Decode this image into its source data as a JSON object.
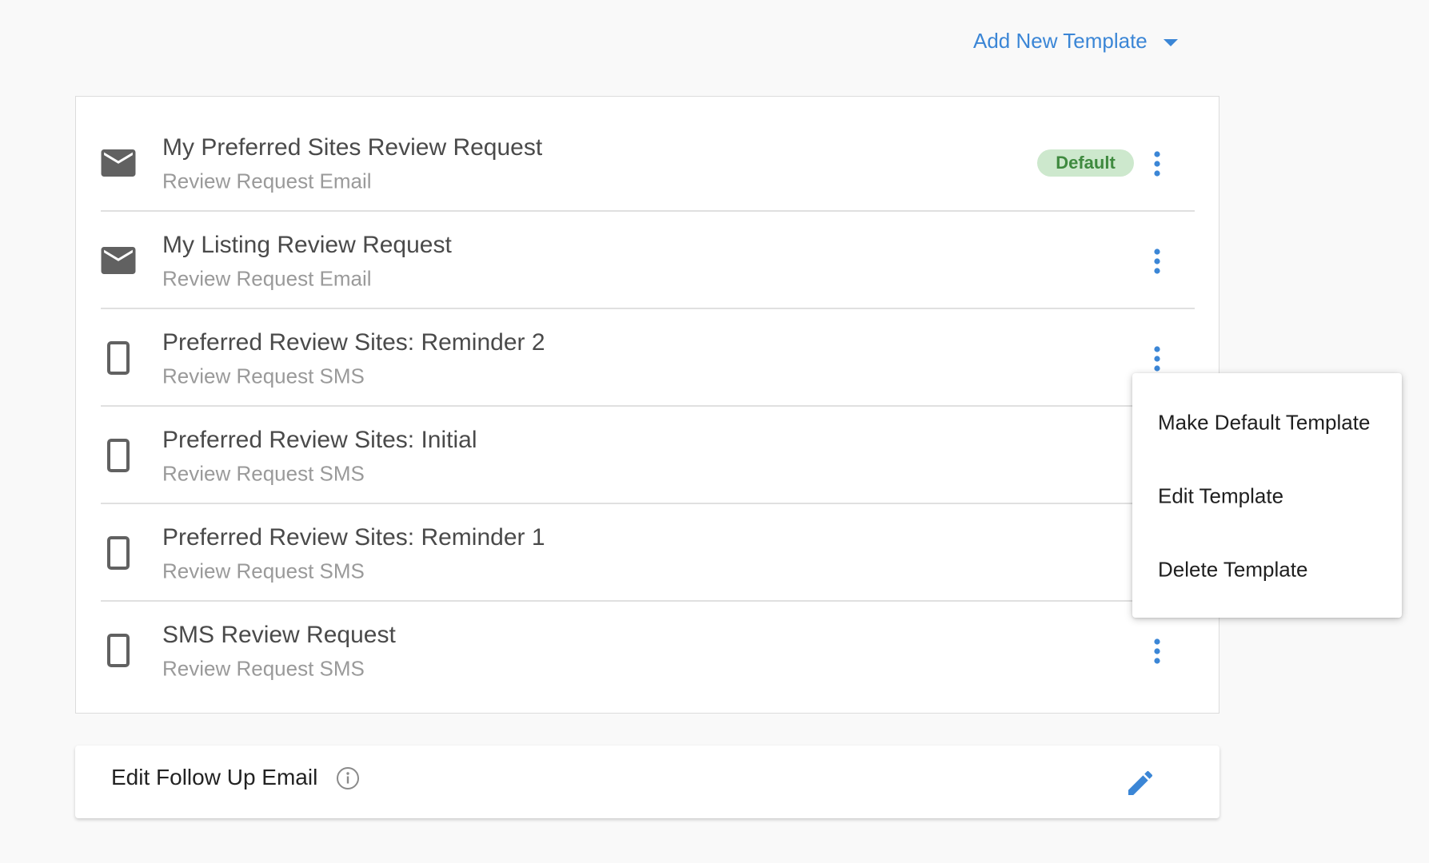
{
  "header": {
    "add_new_label": "Add New Template",
    "add_new_icon": "caret-down-icon"
  },
  "templates": [
    {
      "title": "My Preferred Sites Review Request",
      "type": "Review Request Email",
      "icon": "email-icon",
      "badge": "Default"
    },
    {
      "title": "My Listing Review Request",
      "type": "Review Request Email",
      "icon": "email-icon"
    },
    {
      "title": "Preferred Review Sites: Reminder 2",
      "type": "Review Request SMS",
      "icon": "phone-icon"
    },
    {
      "title": "Preferred Review Sites: Initial",
      "type": "Review Request SMS",
      "icon": "phone-icon"
    },
    {
      "title": "Preferred Review Sites: Reminder 1",
      "type": "Review Request SMS",
      "icon": "phone-icon"
    },
    {
      "title": "SMS Review Request",
      "type": "Review Request SMS",
      "icon": "phone-icon"
    }
  ],
  "context_menu": {
    "items": [
      "Make Default Template",
      "Edit Template",
      "Delete Template"
    ]
  },
  "followup": {
    "label": "Edit Follow Up Email",
    "info_icon": "info-icon",
    "edit_icon": "pencil-icon"
  },
  "colors": {
    "accent": "#3b86d6",
    "badge_bg": "#cde8cd",
    "badge_text": "#3f8a3f",
    "icon_gray": "#616161"
  }
}
